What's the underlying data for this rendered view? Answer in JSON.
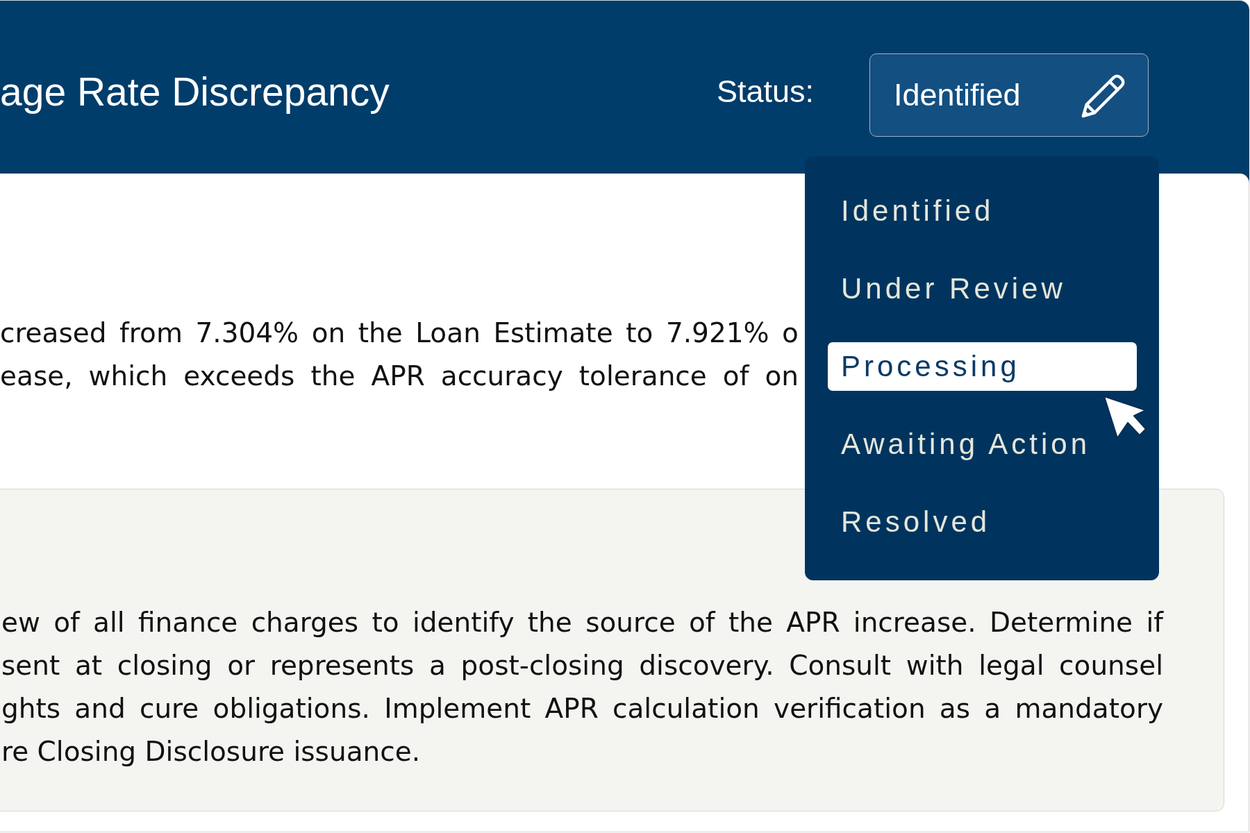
{
  "header": {
    "title": "age Rate Discrepancy",
    "status_label": "Status:",
    "status_button": {
      "value": "Identified"
    }
  },
  "status_menu": {
    "items": [
      {
        "label": "Identified",
        "selected": false
      },
      {
        "label": "Under Review",
        "selected": false
      },
      {
        "label": "Processing",
        "selected": true
      },
      {
        "label": "Awaiting Action",
        "selected": false
      },
      {
        "label": "Resolved",
        "selected": false
      }
    ]
  },
  "description": {
    "lines": [
      "creased from 7.304% on the Loan Estimate to 7.921% o",
      "ease, which exceeds the APR accuracy tolerance of on"
    ]
  },
  "recommendation_panel": {
    "lines": [
      "ew of all finance charges to identify the source of the APR increase. Determine if",
      "sent at closing or represents a post-closing discovery. Consult with legal counsel",
      "ghts and cure obligations. Implement APR calculation verification as a mandatory",
      "re Closing Disclosure issuance."
    ]
  }
}
